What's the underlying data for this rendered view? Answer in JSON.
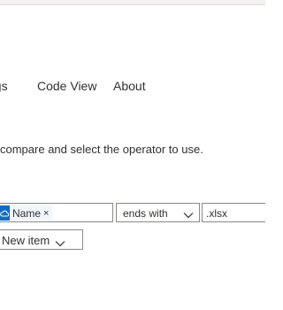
{
  "nav": {
    "tabs": [
      {
        "label": "ngs"
      },
      {
        "label": "Code View"
      },
      {
        "label": "About"
      }
    ]
  },
  "instruction": {
    "text": "compare and select the operator to use."
  },
  "condition": {
    "field_token": {
      "label": "Name",
      "remove_glyph": "×",
      "icon": "cloud-icon"
    },
    "operator": {
      "selected": "ends with",
      "icon": "chevron-down-icon"
    },
    "value": {
      "text": ".xlsx"
    }
  },
  "new_item_button": {
    "label": "New item",
    "icon": "chevron-down-icon"
  },
  "colors": {
    "accent": "#0f6cbd",
    "token_background": "#eff6fc",
    "border": "#8a8886",
    "text": "#323130"
  }
}
